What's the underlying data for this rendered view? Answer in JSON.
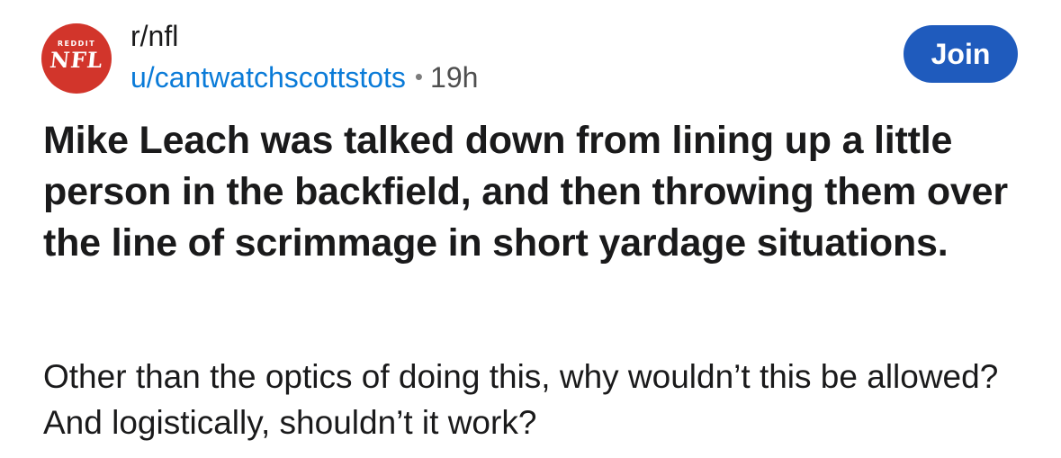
{
  "subreddit": {
    "name": "r/nfl",
    "avatar_top_text": "REDDIT",
    "avatar_main_text": "NFL",
    "avatar_color": "#d2352b"
  },
  "author": "u/cantwatchscottstots",
  "separator": "•",
  "age": "19h",
  "join_button": {
    "label": "Join",
    "color": "#1f5bbd"
  },
  "post": {
    "title": "Mike Leach was talked down from lining up a little person in the backfield, and then throwing them over the line of scrimmage in short yardage situations.",
    "body": "Other than the optics of doing this, why wouldn’t this be allowed? And logistically, shouldn’t it work?"
  },
  "colors": {
    "author_link": "#0a7bd8",
    "text": "#1a1a1b",
    "muted": "#4f4f4f"
  }
}
